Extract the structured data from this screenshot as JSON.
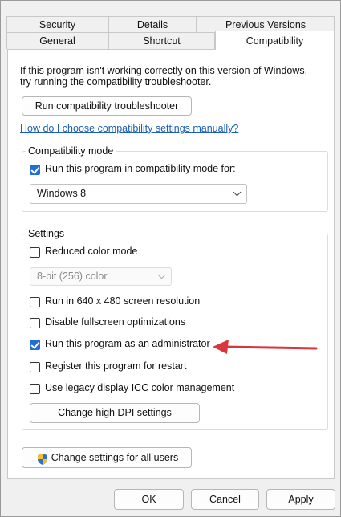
{
  "tabs": {
    "row1": [
      "Security",
      "Details",
      "Previous Versions"
    ],
    "row2": [
      "General",
      "Shortcut",
      "Compatibility"
    ],
    "active": "Compatibility"
  },
  "intro": {
    "line1": "If this program isn't working correctly on this version of Windows,",
    "line2": "try running the compatibility troubleshooter.",
    "troubleshooter_button": "Run compatibility troubleshooter",
    "help_link": "How do I choose compatibility settings manually?"
  },
  "compat_mode": {
    "legend": "Compatibility mode",
    "checkbox_label": "Run this program in compatibility mode for:",
    "checked": true,
    "selected_os": "Windows 8"
  },
  "settings": {
    "legend": "Settings",
    "reduced_color": {
      "label": "Reduced color mode",
      "checked": false
    },
    "color_select": "8-bit (256) color",
    "res_640": {
      "label": "Run in 640 x 480 screen resolution",
      "checked": false
    },
    "fullscreen_opt": {
      "label": "Disable fullscreen optimizations",
      "checked": false
    },
    "run_admin": {
      "label": "Run this program as an administrator",
      "checked": true
    },
    "register_restart": {
      "label": "Register this program for restart",
      "checked": false
    },
    "legacy_icc": {
      "label": "Use legacy display ICC color management",
      "checked": false
    },
    "dpi_button": "Change high DPI settings"
  },
  "all_users_button": "Change settings for all users",
  "footer": {
    "ok": "OK",
    "cancel": "Cancel",
    "apply": "Apply"
  },
  "colors": {
    "arrow": "#d9363e",
    "accent": "#1f6fd6",
    "link": "#1a5fb4"
  }
}
